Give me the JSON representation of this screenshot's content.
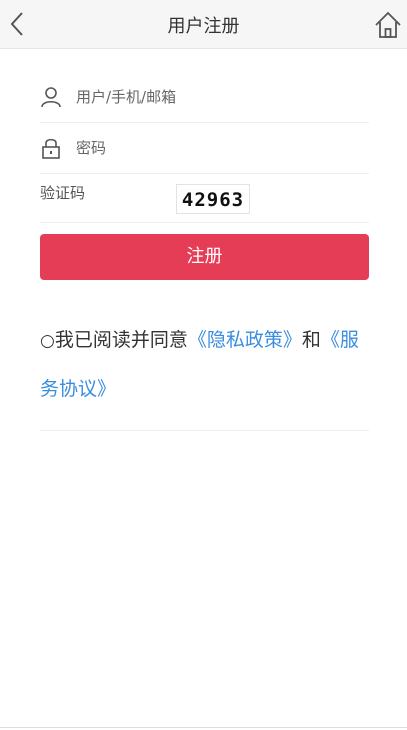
{
  "header": {
    "title": "用户注册",
    "back_icon": "chevron-left-icon",
    "home_icon": "home-icon"
  },
  "form": {
    "account": {
      "placeholder": "用户/手机/邮箱",
      "value": "",
      "icon": "user-icon"
    },
    "password": {
      "placeholder": "密码",
      "value": "",
      "icon": "lock-icon"
    },
    "captcha": {
      "label": "验证码",
      "code": "4296З"
    }
  },
  "register_button": {
    "label": "注册",
    "color": "#e63d57"
  },
  "agreement": {
    "radio": "○",
    "prefix": "我已阅读并同意",
    "privacy_link": "《隐私政策》",
    "conjunction": "和",
    "terms_link": "《服务协议》",
    "link_color": "#3a8de0"
  }
}
